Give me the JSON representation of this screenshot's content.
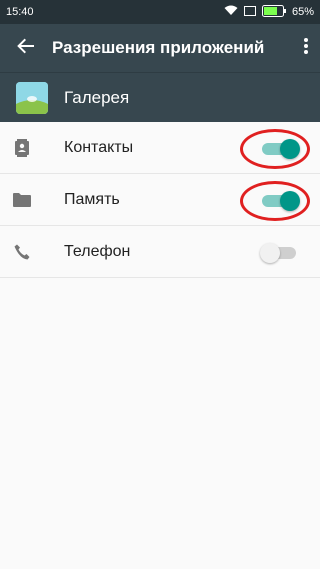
{
  "status": {
    "time": "15:40",
    "battery": "65%"
  },
  "appbar": {
    "title": "Разрешения приложений",
    "back_icon": "arrow-back-icon",
    "more_icon": "more-vert-icon"
  },
  "app": {
    "name": "Галерея",
    "icon": "gallery-app-icon"
  },
  "permissions": [
    {
      "label": "Контакты",
      "icon": "contacts-icon",
      "enabled": true
    },
    {
      "label": "Память",
      "icon": "folder-icon",
      "enabled": true
    },
    {
      "label": "Телефон",
      "icon": "phone-icon",
      "enabled": false
    }
  ],
  "colors": {
    "switch_on": "#009688",
    "annotation": "#e02020",
    "toolbar": "#37474f"
  }
}
